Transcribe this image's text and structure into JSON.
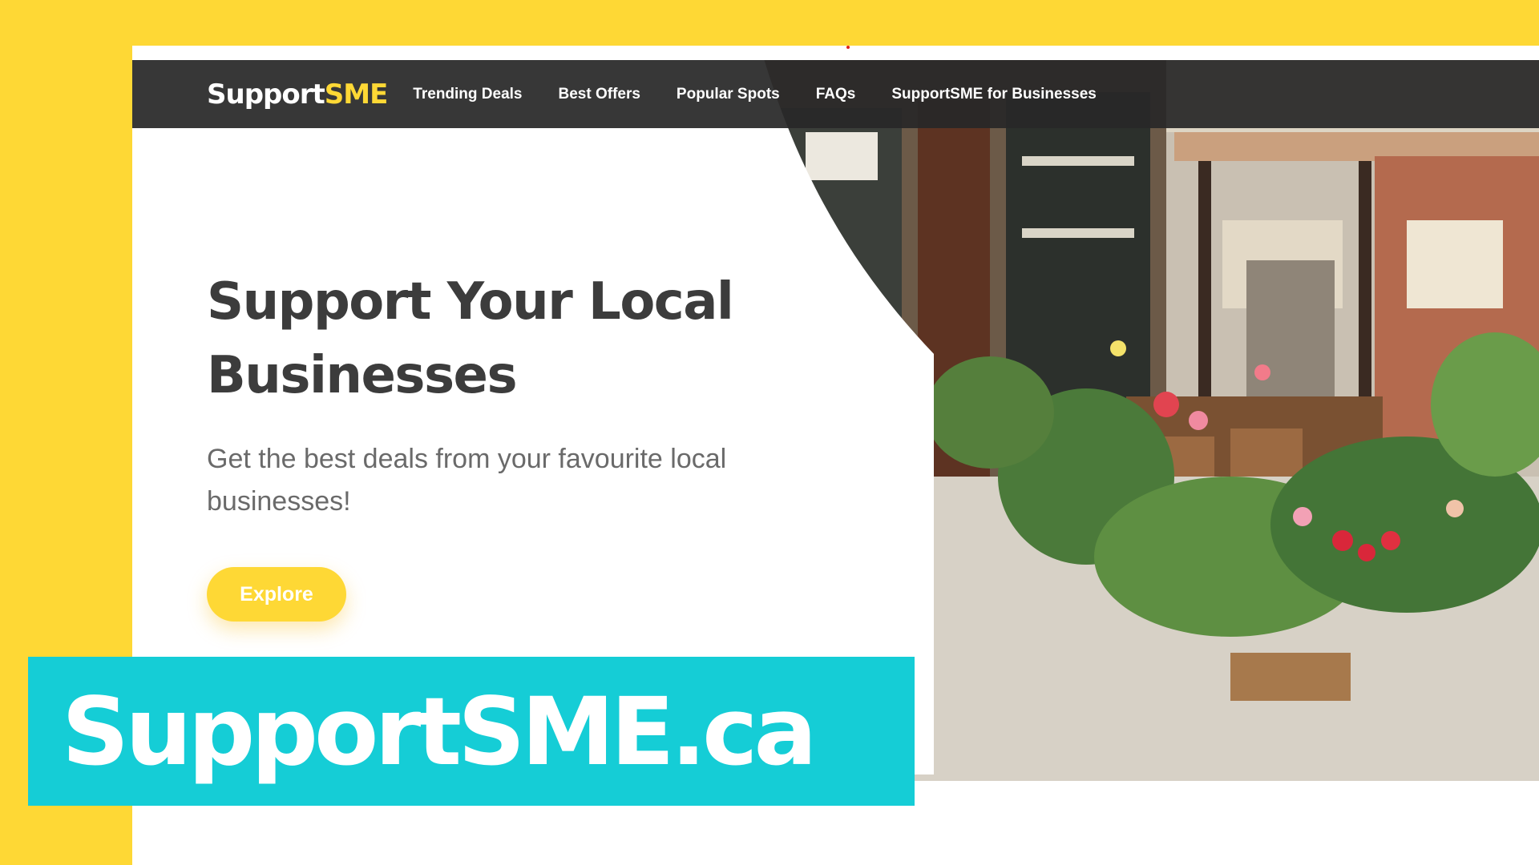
{
  "colors": {
    "backdrop": "#fed835",
    "nav_bg": "#2b2b2b",
    "accent": "#fed835",
    "banner": "#15cdd6",
    "heading": "#3c3c3c",
    "subtext": "#6a6a6a"
  },
  "nav": {
    "logo_main": "Support",
    "logo_accent": "SME",
    "links": [
      "Trending Deals",
      "Best Offers",
      "Popular Spots",
      "FAQs",
      "SupportSME for Businesses"
    ]
  },
  "hero": {
    "title_line1": "Support Your Local",
    "title_line2": "Businesses",
    "subtitle": "Get the best deals from your favourite local businesses!",
    "cta_label": "Explore"
  },
  "banner": {
    "text": "SupportSME.ca"
  },
  "icons": {
    "hero_image": "flower-shop-storefront-photo"
  }
}
